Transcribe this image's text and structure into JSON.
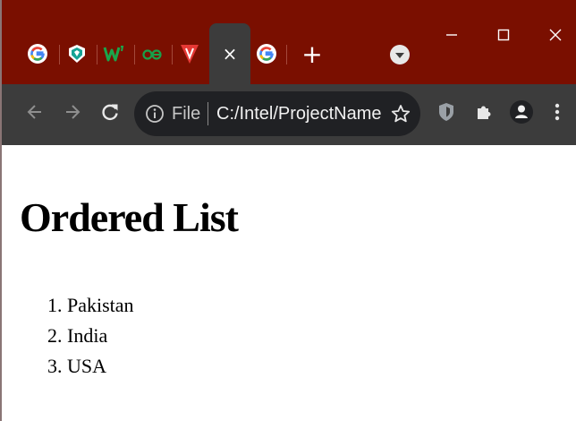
{
  "window": {
    "controls": {
      "minimize": "minimize",
      "maximize": "maximize",
      "close": "close"
    }
  },
  "tabs": [
    {
      "icon": "google-g-icon",
      "color": "#4285f4"
    },
    {
      "icon": "shield-gem-icon",
      "color": "#15a394"
    },
    {
      "icon": "w-letter-icon",
      "color": "#1aa64b"
    },
    {
      "icon": "ae-ligature-icon",
      "color": "#19a04a"
    },
    {
      "icon": "v-triangle-icon",
      "color": "#e53935"
    }
  ],
  "active_tab": {
    "close_label": "×"
  },
  "tab_after_active": {
    "icon": "google-g-icon"
  },
  "new_tab_label": "+",
  "toolbar": {
    "back_icon": "arrow-left-icon",
    "forward_icon": "arrow-right-icon",
    "reload_icon": "reload-icon",
    "omnibox": {
      "info_icon": "info-icon",
      "scheme_label": "File",
      "url": "C:/Intel/ProjectName..."
    },
    "star_icon": "star-icon",
    "extensions": [
      "shield-extension-icon",
      "puzzle-icon",
      "profile-icon",
      "kebab-menu-icon"
    ]
  },
  "page": {
    "heading": "Ordered List",
    "list_items": [
      "1. Pakistan",
      "2. India",
      "3. USA"
    ]
  },
  "colors": {
    "tabstrip": "#7a0f00",
    "toolbar": "#3c3c3c",
    "omnibox": "#202124",
    "page_background": "#ffffff"
  }
}
